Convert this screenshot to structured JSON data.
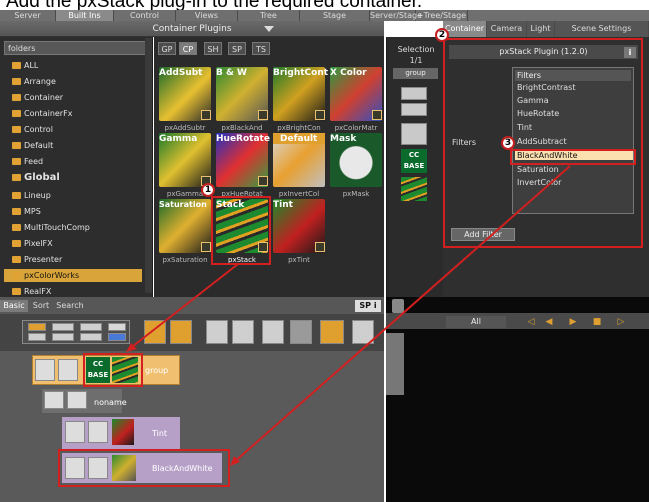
{
  "caption": "Add the pxStack plug-in to the required container.",
  "top_tabs": [
    "Server",
    "Built Ins",
    "Control",
    "Views",
    "Tree",
    "Stage",
    "Server/Stage",
    "+Tree/Stage"
  ],
  "right_tabs": [
    "Container",
    "Camera",
    "Light",
    "Scene Settings"
  ],
  "plugin_bar": {
    "label": "Container Plugins"
  },
  "folders": {
    "header": "folders",
    "items": [
      "ALL",
      "Arrange",
      "Container",
      "ContainerFx",
      "Control",
      "Default",
      "Feed",
      "Global",
      "Lineup",
      "MPS",
      "MultiTouchComp",
      "PixelFX",
      "Presenter",
      "pxColorWorks",
      "RealFX"
    ]
  },
  "grid_tabs": [
    "GP",
    "CP",
    "SH",
    "SP",
    "TS"
  ],
  "plugins": [
    {
      "name": "AddSubt",
      "sub": "pxAddSubtr"
    },
    {
      "name": "B & W",
      "sub": "pxBlackAnd"
    },
    {
      "name": "BrightCont",
      "sub": "pxBrightCon"
    },
    {
      "name": "X Color",
      "sub": "pxColorMatr"
    },
    {
      "name": "Gamma",
      "sub": "pxGamma"
    },
    {
      "name": "HueRotate",
      "sub": "pxHueRotat"
    },
    {
      "name": "Default",
      "sub": "pxInvertCol"
    },
    {
      "name": "Mask",
      "sub": "pxMask"
    },
    {
      "name": "Saturation",
      "sub": "pxSaturation"
    },
    {
      "name": "Stack",
      "sub": "pxStack"
    },
    {
      "name": "Tint",
      "sub": "pxTint"
    }
  ],
  "selection": {
    "title": "Selection",
    "count": "1/1",
    "group": "group",
    "cc_label": "CC BASE"
  },
  "right_panel": {
    "title": "pxStack Plugin (1.2.0)",
    "info": "i",
    "filters_label": "Filters",
    "list_header": "Filters",
    "filters": [
      "BrightContrast",
      "Gamma",
      "HueRotate",
      "Tint",
      "AddSubtract",
      "BlackAndWhite",
      "Saturation",
      "InvertColor"
    ],
    "selected_filter": "BlackAndWhite",
    "add_filter": "Add Filter"
  },
  "bottom_tabs": [
    "Basic",
    "Sort",
    "Search"
  ],
  "bottom_right_tools": "SP i",
  "anim": {
    "all": "All"
  },
  "tree": {
    "group_label": "group",
    "noname_label": "noname",
    "tint_label": "Tint",
    "bw_label": "BlackAndWhite",
    "cc_label": "CC BASE"
  },
  "badges": [
    "1",
    "2",
    "3"
  ],
  "colors": {
    "accent": "#d9a53a",
    "highlight_red": "#d21f1f"
  }
}
